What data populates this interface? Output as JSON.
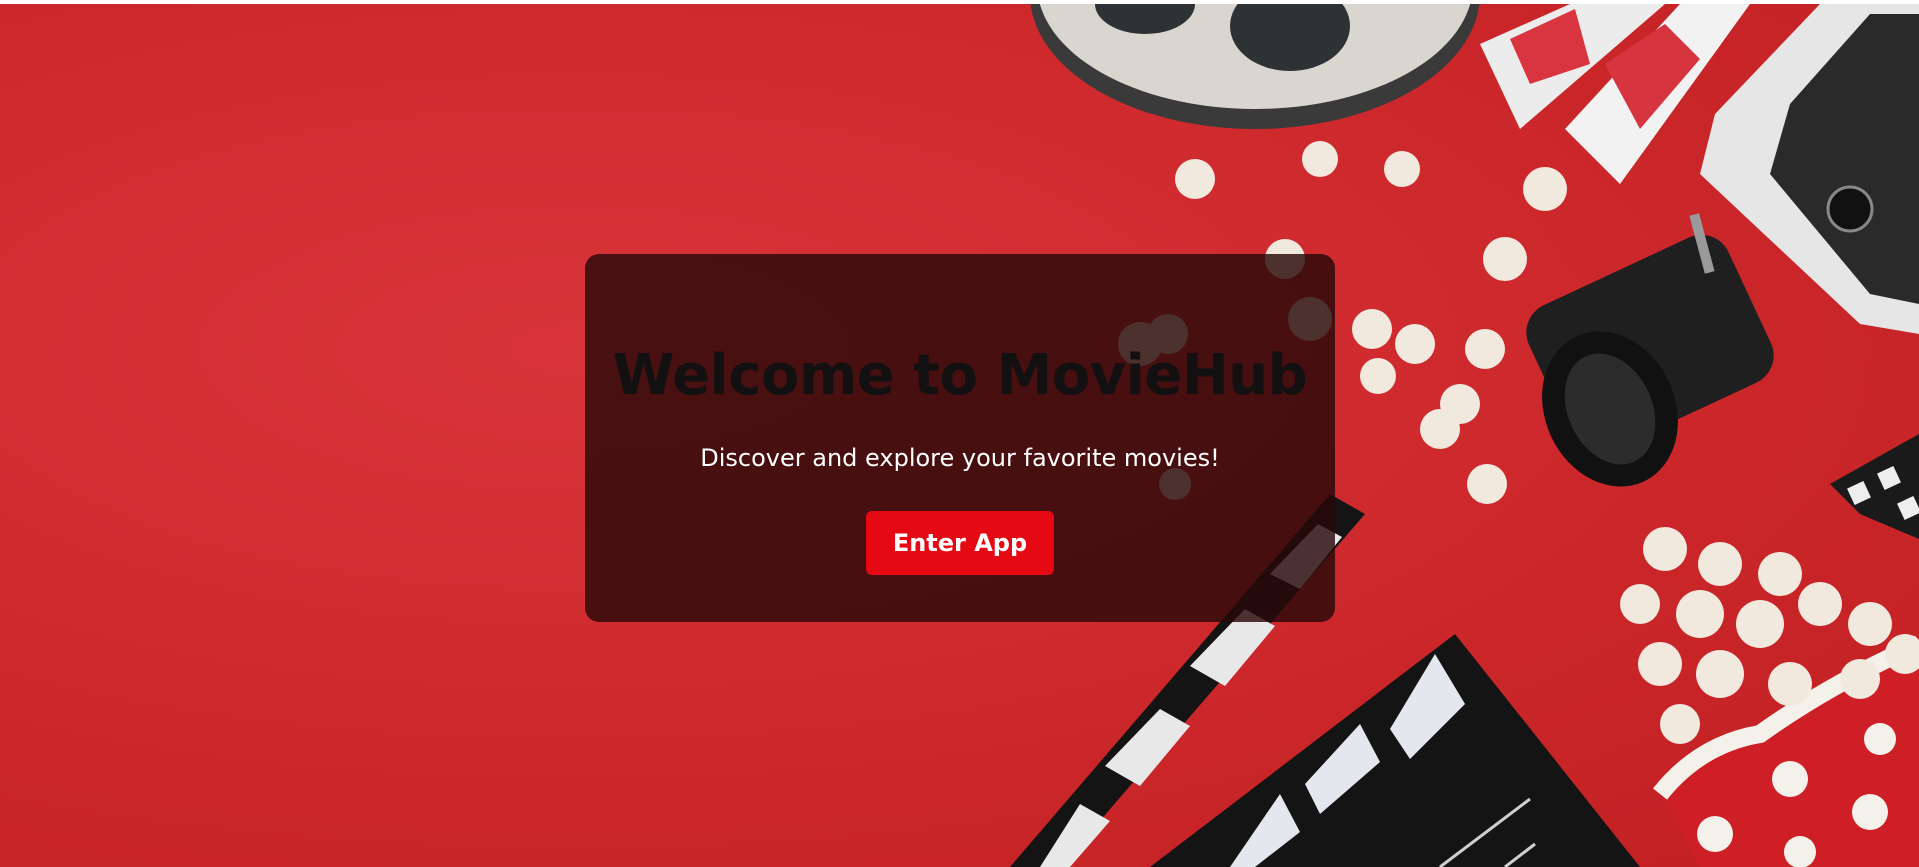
{
  "hero": {
    "title": "Welcome to MovieHub",
    "subtitle": "Discover and explore your favorite movies!",
    "enter_button_label": "Enter App"
  },
  "colors": {
    "background_red": "#cf2a2e",
    "card_overlay": "rgba(40,8,8,0.82)",
    "button_red": "#e50914",
    "title_text": "#121010",
    "subtitle_text": "#ffffff"
  },
  "decor_icons": [
    "film-reel-icon",
    "3d-glasses-icon",
    "movie-camera-icon",
    "popcorn-icon",
    "clapperboard-icon",
    "film-strip-icon",
    "popcorn-box-icon"
  ]
}
